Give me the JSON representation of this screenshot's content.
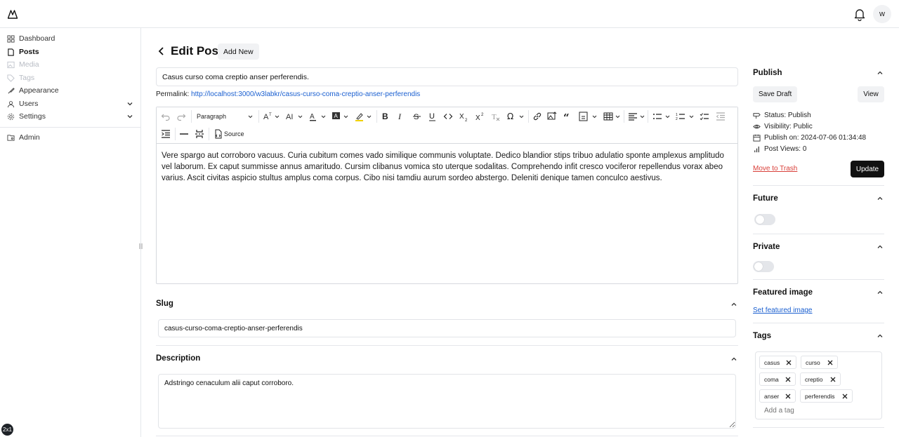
{
  "topbar": {
    "avatar_initial": "w"
  },
  "sidebar": {
    "items": [
      {
        "label": "Dashboard"
      },
      {
        "label": "Posts"
      },
      {
        "label": "Media"
      },
      {
        "label": "Tags"
      },
      {
        "label": "Appearance"
      },
      {
        "label": "Users"
      },
      {
        "label": "Settings"
      },
      {
        "label": "Admin"
      }
    ]
  },
  "badge": "2x1",
  "header": {
    "title": "Edit Post",
    "add_new_label": "Add New"
  },
  "post": {
    "title": "Casus curso coma creptio anser perferendis.",
    "permalink_label": "Permalink:",
    "permalink_url": "http://localhost:3000/w3labkr/casus-curso-coma-creptio-anser-perferendis",
    "content": "Vere spargo aut corroboro vacuus. Curia cubitum comes vado similique communis voluptate. Dedico blandior stips tribuo adulatio sponte amplexus amplitudo vel laborum. Ex caput summisse annus amaritudo. Cursim clibanus vomica sto uterque sodalitas. Comprehendo infit cresco vociferor repellendus vorax abeo varius. Ascit civitas aspicio stultus amplus coma corpus. Cibo nisi tamdiu aurum sordeo abstergo. Deleniti denique tamen conculco aestivus."
  },
  "toolbar": {
    "paragraph_label": "Paragraph",
    "source_label": "Source"
  },
  "slug": {
    "title": "Slug",
    "value": "casus-curso-coma-creptio-anser-perferendis"
  },
  "description": {
    "title": "Description",
    "value": "Adstringo cenaculum alii caput corroboro."
  },
  "publish": {
    "title": "Publish",
    "save_draft_label": "Save Draft",
    "view_label": "View",
    "status": "Status: Publish",
    "visibility": "Visibility: Public",
    "publish_on": "Publish on: 2024-07-06 01:34:48",
    "views": "Post Views: 0",
    "trash_label": "Move to Trash",
    "update_label": "Update"
  },
  "future": {
    "title": "Future",
    "enabled": false
  },
  "private": {
    "title": "Private",
    "enabled": false
  },
  "featured_image": {
    "title": "Featured image",
    "link_label": "Set featured image"
  },
  "tags": {
    "title": "Tags",
    "items": [
      "casus",
      "curso",
      "coma",
      "creptio",
      "anser",
      "perferendis"
    ],
    "placeholder": "Add a tag"
  },
  "colors": {
    "link": "#1a5fd0",
    "danger": "#d9403a",
    "primary": "#111111"
  }
}
